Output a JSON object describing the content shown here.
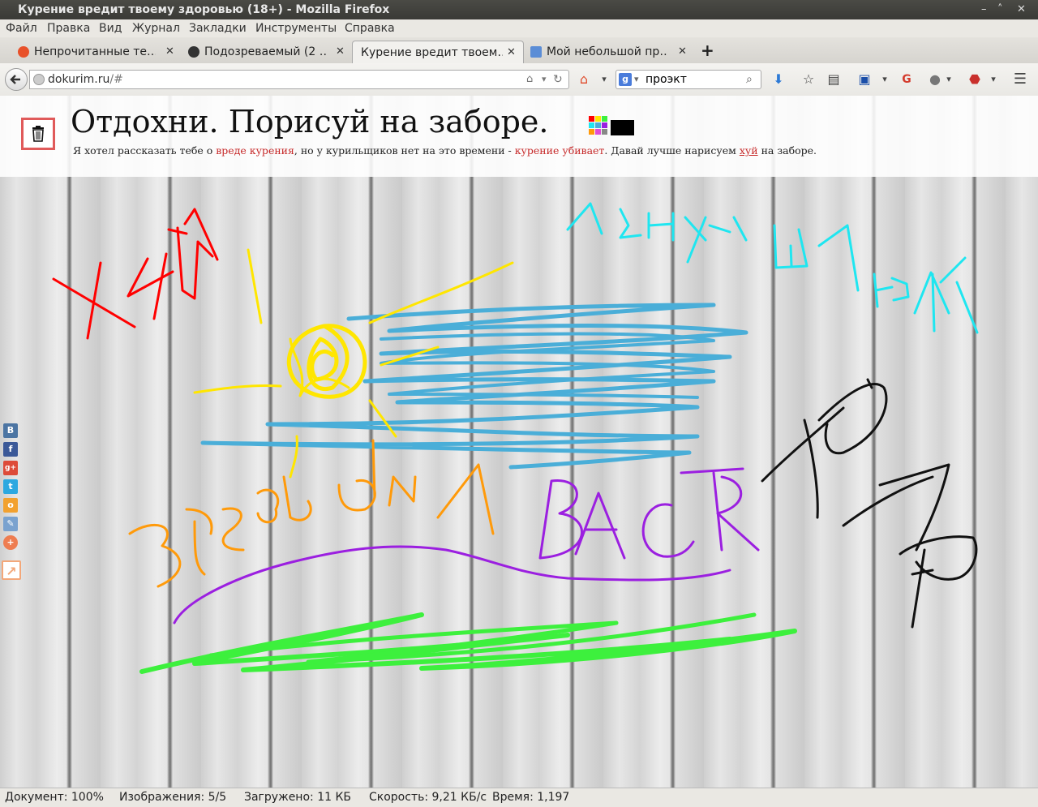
{
  "window": {
    "title": "Курение вредит твоему здоровью (18+) - Mozilla Firefox",
    "controls": [
      "–",
      "˄",
      "✕"
    ]
  },
  "menu": {
    "items": [
      "Файл",
      "Правка",
      "Вид",
      "Журнал",
      "Закладки",
      "Инструменты",
      "Справка"
    ]
  },
  "tabs": [
    {
      "label": "Непрочитанные те…",
      "close": "✕",
      "color": "#e8512a"
    },
    {
      "label": "Подозреваемый (2 …",
      "close": "✕",
      "color": "#333333"
    },
    {
      "label": "Курение вредит твоем…",
      "close": "✕",
      "color": "#f2f1ee"
    },
    {
      "label": "Мой небольшой пр…",
      "close": "✕",
      "color": "#5b8dd6"
    }
  ],
  "new_tab": "+",
  "nav": {
    "url_host": "dokurim.ru",
    "url_path": "/#",
    "search_value": "проэкт",
    "search_engine": "g-icon"
  },
  "page": {
    "title": "Отдохни. Порисуй на заборе.",
    "sub": {
      "p1": "Я хотел рассказать тебе о ",
      "link1": "вреде курения",
      "p2": ", но у курильщиков нет на это времени - ",
      "link2": "курение убивает",
      "p3": ". Давай лучше нарисуем ",
      "link3": "хуй",
      "p4": " на заборе."
    },
    "share_buttons": [
      {
        "icon": "vk-icon",
        "glyph": "В",
        "color": "#4c75a3"
      },
      {
        "icon": "facebook-icon",
        "glyph": "f",
        "color": "#3b5998"
      },
      {
        "icon": "googleplus-icon",
        "glyph": "g+",
        "color": "#dd4b39"
      },
      {
        "icon": "twitter-icon",
        "glyph": "t",
        "color": "#2ca8e0"
      },
      {
        "icon": "odnoklassniki-icon",
        "glyph": "о",
        "color": "#f2a12f"
      },
      {
        "icon": "livejournal-icon",
        "glyph": "✎",
        "color": "#7aa2cf"
      },
      {
        "icon": "add-more-icon",
        "glyph": "+",
        "color": "#ee7d51"
      },
      {
        "icon": "external-share-icon",
        "glyph": "↗",
        "color": "#f3a779"
      }
    ]
  },
  "drawing_colors": {
    "red": "#ff0000",
    "yellow": "#ffe600",
    "blue": "#4aaed8",
    "cyan": "#1fe6f0",
    "orange": "#ff9a0a",
    "purple": "#9b1fe0",
    "green": "#3df03d",
    "black": "#111111"
  },
  "status": {
    "document": "Документ: 100%",
    "images": "Изображения: 5/5",
    "loaded": "Загружено: 11 КБ",
    "speed": "Скорость: 9,21 КБ/с",
    "time": "Время: 1,197"
  }
}
